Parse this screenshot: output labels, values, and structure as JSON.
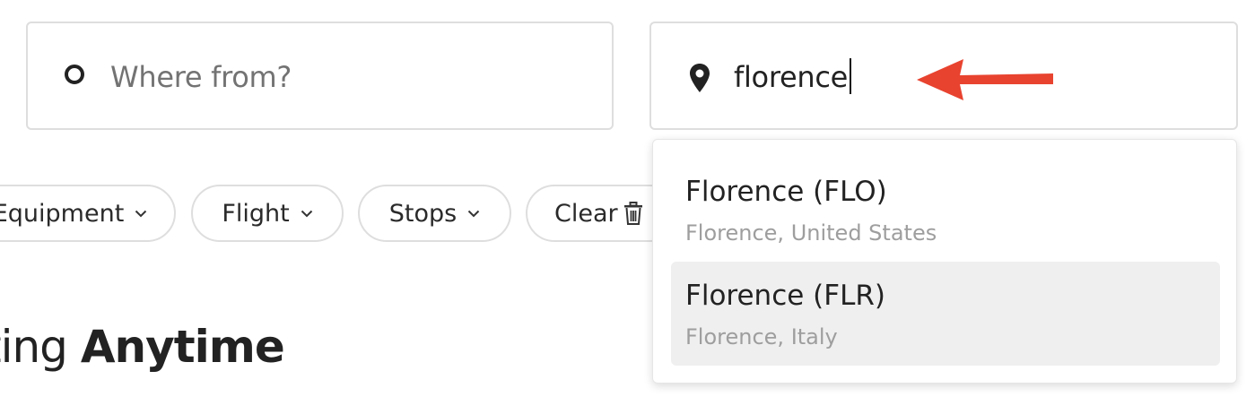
{
  "search": {
    "from": {
      "placeholder": "Where from?",
      "icon": "origin-circle-icon"
    },
    "to": {
      "value": "florence",
      "icon": "location-pin-icon"
    }
  },
  "annotation": {
    "icon": "red-arrow-icon",
    "color": "#e8432f"
  },
  "filters": [
    {
      "label": "Equipment",
      "icon": "chevron-down-icon"
    },
    {
      "label": "Flight",
      "icon": "chevron-down-icon"
    },
    {
      "label": "Stops",
      "icon": "chevron-down-icon"
    },
    {
      "label": "Clear",
      "icon": "trash-icon"
    }
  ],
  "heading": {
    "prefix": "ting",
    "emphasis": "Anytime"
  },
  "suggestions": [
    {
      "title": "Florence (FLO)",
      "subtitle": "Florence, United States",
      "highlighted": false
    },
    {
      "title": "Florence (FLR)",
      "subtitle": "Florence, Italy",
      "highlighted": true
    }
  ],
  "colors": {
    "highlight": "#efefef",
    "border": "#dedede",
    "muted_text": "#9e9e9e"
  }
}
